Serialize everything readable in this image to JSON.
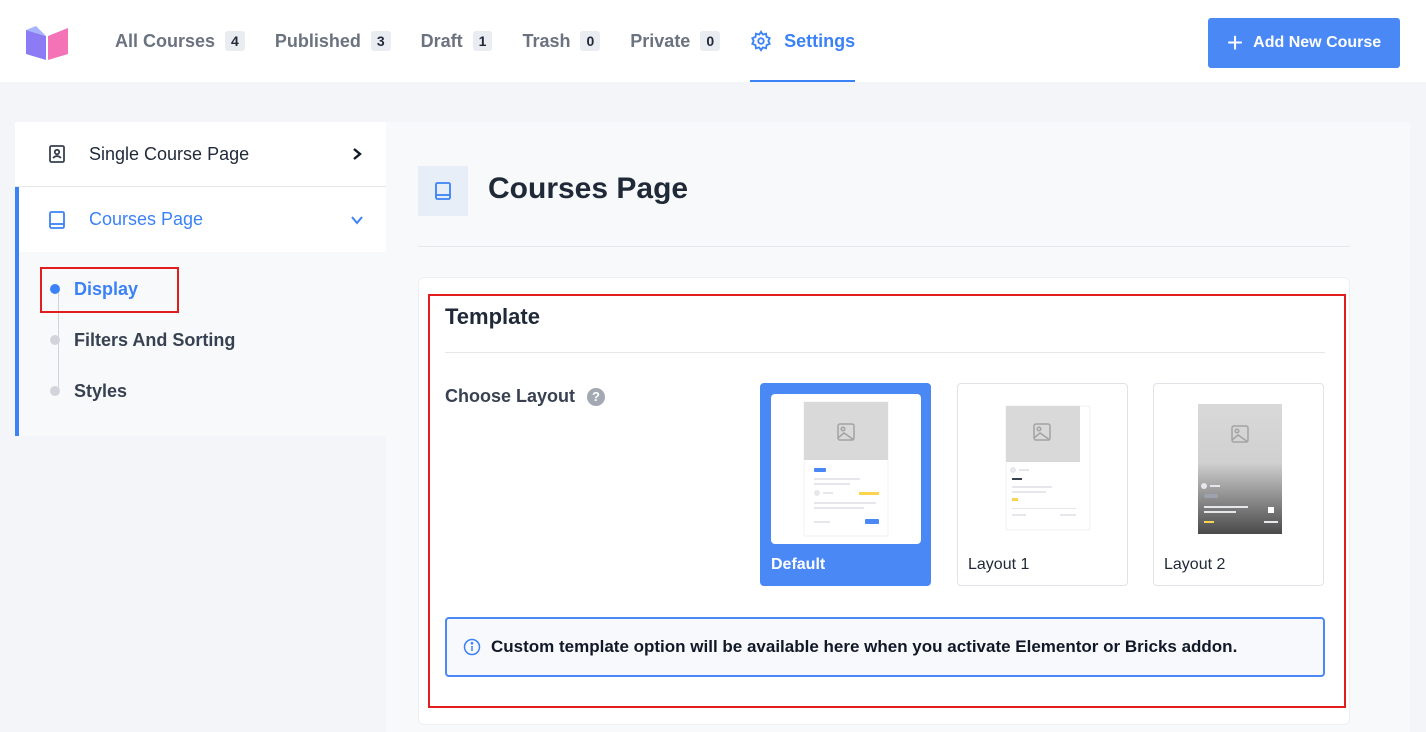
{
  "header": {
    "tabs": [
      {
        "label": "All Courses",
        "count": "4"
      },
      {
        "label": "Published",
        "count": "3"
      },
      {
        "label": "Draft",
        "count": "1"
      },
      {
        "label": "Trash",
        "count": "0"
      },
      {
        "label": "Private",
        "count": "0"
      },
      {
        "label": "Settings"
      }
    ],
    "add_button": "Add New Course",
    "accent_color": "#4a88f5"
  },
  "sidebar": {
    "single_course": "Single Course Page",
    "courses_page": "Courses Page",
    "sub_items": [
      "Display",
      "Filters And Sorting",
      "Styles"
    ]
  },
  "main": {
    "title": "Courses Page",
    "card_title": "Template",
    "choose_layout": "Choose Layout",
    "help_icon": "?",
    "layouts": [
      "Default",
      "Layout 1",
      "Layout 2"
    ],
    "selected_layout": "Default",
    "notice": "Custom template option will be available here when you activate Elementor or Bricks addon."
  }
}
